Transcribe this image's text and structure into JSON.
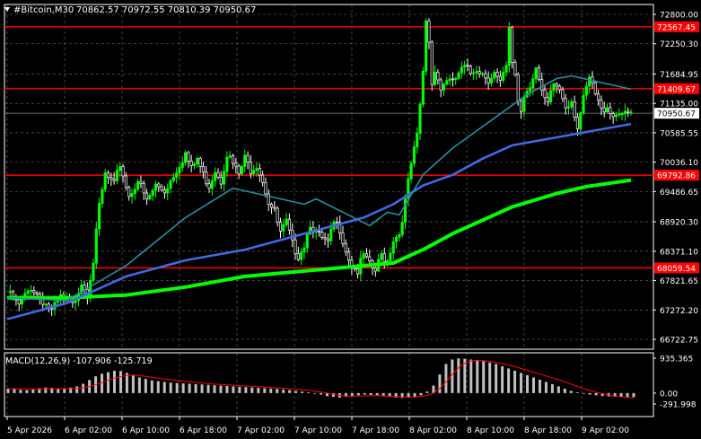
{
  "header": {
    "menu_icon": "triangle-down-icon",
    "symbol": "#Bitcoin,M30",
    "ohlc": "70862.57 70972.55 70810.39 70950.67"
  },
  "colors": {
    "background": "#000000",
    "grid": "#c8c8c8",
    "bull": "#00ff00",
    "bear": "#ffffff",
    "ma_fast": "#2a8fa0",
    "ma_mid": "#4169e1",
    "ma_slow": "#00ff00",
    "level": "#ff0000",
    "macd_hist": "#c0c0c0",
    "macd_signal": "#ff0000",
    "price_tag": "#ffffff"
  },
  "chart_data": [
    {
      "type": "candlestick",
      "symbol": "#Bitcoin",
      "timeframe": "M30",
      "y_ticks": [
        "72800.00",
        "72250.30",
        "71684.95",
        "71135.00",
        "70585.55",
        "70036.10",
        "69486.65",
        "68920.30",
        "68371.10",
        "67821.65",
        "67272.20",
        "66722.75"
      ],
      "ylim": [
        66722.75,
        72800.0
      ],
      "x_ticks": [
        "5 Apr 2026",
        "6 Apr 02:00",
        "6 Apr 10:00",
        "6 Apr 18:00",
        "7 Apr 02:00",
        "7 Apr 10:00",
        "7 Apr 18:00",
        "8 Apr 02:00",
        "8 Apr 10:00",
        "8 Apr 18:00",
        "9 Apr 02:00"
      ],
      "levels": [
        {
          "value": 72567.45,
          "label": "72567.45"
        },
        {
          "value": 71409.67,
          "label": "71409.67"
        },
        {
          "value": 69792.86,
          "label": "69792.86"
        },
        {
          "value": 68059.54,
          "label": "68059.54"
        }
      ],
      "last_price": {
        "value": 70950.67,
        "label": "70950.67"
      },
      "price_path": [
        [
          0,
          67600
        ],
        [
          4,
          67350
        ],
        [
          8,
          67700
        ],
        [
          12,
          67450
        ],
        [
          15,
          67250
        ],
        [
          18,
          67500
        ],
        [
          22,
          67350
        ],
        [
          25,
          67800
        ],
        [
          27,
          67600
        ],
        [
          29,
          68200
        ],
        [
          31,
          69200
        ],
        [
          33,
          69800
        ],
        [
          36,
          69600
        ],
        [
          38,
          70000
        ],
        [
          41,
          69400
        ],
        [
          44,
          69700
        ],
        [
          47,
          69300
        ],
        [
          50,
          69600
        ],
        [
          53,
          69500
        ],
        [
          56,
          69800
        ],
        [
          58,
          70000
        ],
        [
          60,
          70200
        ],
        [
          62,
          69900
        ],
        [
          64,
          70100
        ],
        [
          66,
          69800
        ],
        [
          68,
          69600
        ],
        [
          70,
          69900
        ],
        [
          72,
          69700
        ],
        [
          74,
          70200
        ],
        [
          76,
          70000
        ],
        [
          78,
          69800
        ],
        [
          80,
          70100
        ],
        [
          82,
          69900
        ],
        [
          84,
          70000
        ],
        [
          86,
          69700
        ],
        [
          88,
          69300
        ],
        [
          90,
          69100
        ],
        [
          92,
          68700
        ],
        [
          94,
          68900
        ],
        [
          96,
          68500
        ],
        [
          98,
          68300
        ],
        [
          100,
          68500
        ],
        [
          102,
          68900
        ],
        [
          104,
          68700
        ],
        [
          106,
          68600
        ],
        [
          108,
          68500
        ],
        [
          110,
          68900
        ],
        [
          112,
          68800
        ],
        [
          114,
          68400
        ],
        [
          116,
          68100
        ],
        [
          118,
          68000
        ],
        [
          120,
          68300
        ],
        [
          122,
          68100
        ],
        [
          124,
          68000
        ],
        [
          126,
          68300
        ],
        [
          128,
          68200
        ],
        [
          130,
          68600
        ],
        [
          132,
          68700
        ],
        [
          134,
          69300
        ],
        [
          136,
          70000
        ],
        [
          138,
          70500
        ],
        [
          139,
          71100
        ],
        [
          140,
          71700
        ],
        [
          141,
          72700
        ],
        [
          142,
          72300
        ],
        [
          143,
          71500
        ],
        [
          144,
          71800
        ],
        [
          146,
          71400
        ],
        [
          148,
          71600
        ],
        [
          150,
          71500
        ],
        [
          152,
          71700
        ],
        [
          154,
          71800
        ],
        [
          156,
          71700
        ],
        [
          158,
          71800
        ],
        [
          160,
          71700
        ],
        [
          162,
          71600
        ],
        [
          164,
          71700
        ],
        [
          166,
          71500
        ],
        [
          168,
          71800
        ],
        [
          169,
          72500
        ],
        [
          170,
          71900
        ],
        [
          171,
          71700
        ],
        [
          172,
          71200
        ],
        [
          173,
          71000
        ],
        [
          174,
          71300
        ],
        [
          176,
          71500
        ],
        [
          178,
          71800
        ],
        [
          180,
          71300
        ],
        [
          182,
          71100
        ],
        [
          184,
          71500
        ],
        [
          186,
          71400
        ],
        [
          188,
          71100
        ],
        [
          190,
          71200
        ],
        [
          192,
          70700
        ],
        [
          194,
          71200
        ],
        [
          196,
          71600
        ],
        [
          198,
          71300
        ],
        [
          200,
          71000
        ],
        [
          202,
          71100
        ],
        [
          204,
          70900
        ],
        [
          206,
          71000
        ],
        [
          208,
          70900
        ],
        [
          210,
          70950
        ]
      ],
      "ma_fast": [
        [
          0,
          67500
        ],
        [
          20,
          67450
        ],
        [
          40,
          68100
        ],
        [
          60,
          69000
        ],
        [
          76,
          69550
        ],
        [
          100,
          69250
        ],
        [
          104,
          69350
        ],
        [
          122,
          68850
        ],
        [
          128,
          69100
        ],
        [
          132,
          69050
        ],
        [
          140,
          69800
        ],
        [
          150,
          70300
        ],
        [
          165,
          70900
        ],
        [
          175,
          71300
        ],
        [
          185,
          71600
        ],
        [
          190,
          71650
        ],
        [
          198,
          71550
        ],
        [
          210,
          71400
        ]
      ],
      "ma_mid": [
        [
          0,
          67100
        ],
        [
          20,
          67400
        ],
        [
          40,
          67900
        ],
        [
          60,
          68200
        ],
        [
          80,
          68400
        ],
        [
          100,
          68700
        ],
        [
          120,
          69000
        ],
        [
          130,
          69250
        ],
        [
          140,
          69600
        ],
        [
          150,
          69800
        ],
        [
          160,
          70100
        ],
        [
          170,
          70350
        ],
        [
          185,
          70500
        ],
        [
          195,
          70600
        ],
        [
          210,
          70750
        ]
      ],
      "ma_slow": [
        [
          0,
          67500
        ],
        [
          20,
          67500
        ],
        [
          40,
          67550
        ],
        [
          60,
          67700
        ],
        [
          80,
          67900
        ],
        [
          100,
          68000
        ],
        [
          120,
          68100
        ],
        [
          130,
          68150
        ],
        [
          140,
          68400
        ],
        [
          150,
          68700
        ],
        [
          160,
          68950
        ],
        [
          170,
          69200
        ],
        [
          185,
          69450
        ],
        [
          195,
          69580
        ],
        [
          210,
          69700
        ]
      ]
    },
    {
      "type": "macd",
      "label": "MACD(12,26,9) -107.906 -125.719",
      "params": "12,26,9",
      "macd": -107.906,
      "signal": -125.719,
      "y_ticks": [
        "935.365",
        "0.00",
        "-291.998"
      ],
      "ylim": [
        -291.998,
        935.365
      ],
      "histogram": [
        120,
        110,
        90,
        80,
        100,
        130,
        150,
        140,
        130,
        120,
        150,
        180,
        250,
        350,
        450,
        520,
        560,
        600,
        590,
        540,
        480,
        420,
        380,
        340,
        320,
        300,
        280,
        270,
        260,
        250,
        240,
        230,
        220,
        210,
        200,
        190,
        180,
        170,
        160,
        150,
        140,
        130,
        120,
        110,
        95,
        80,
        60,
        40,
        20,
        0,
        -40,
        -80,
        -100,
        -120,
        -100,
        -80,
        -60,
        -40,
        -50,
        -60,
        -80,
        -100,
        -120,
        -130,
        -120,
        -100,
        -60,
        40,
        200,
        500,
        780,
        900,
        930,
        920,
        900,
        880,
        860,
        820,
        780,
        720,
        660,
        600,
        540,
        480,
        420,
        360,
        300,
        240,
        180,
        120,
        60,
        20,
        -10,
        -40,
        -60,
        -80,
        -90,
        -100,
        -110,
        -105,
        -108
      ],
      "signal_line": [
        120,
        118,
        115,
        110,
        105,
        106,
        110,
        115,
        118,
        120,
        122,
        128,
        145,
        175,
        220,
        280,
        340,
        400,
        440,
        470,
        480,
        470,
        450,
        420,
        400,
        380,
        360,
        340,
        320,
        300,
        285,
        270,
        255,
        240,
        230,
        220,
        210,
        200,
        190,
        180,
        170,
        160,
        150,
        140,
        130,
        118,
        105,
        90,
        75,
        55,
        30,
        0,
        -30,
        -60,
        -80,
        -85,
        -80,
        -75,
        -70,
        -70,
        -75,
        -85,
        -95,
        -105,
        -110,
        -105,
        -90,
        -60,
        0,
        120,
        300,
        500,
        680,
        800,
        860,
        880,
        870,
        850,
        820,
        790,
        750,
        710,
        660,
        610,
        560,
        510,
        460,
        410,
        360,
        300,
        240,
        180,
        120,
        70,
        20,
        -20,
        -50,
        -80,
        -100,
        -115,
        -125
      ]
    }
  ]
}
